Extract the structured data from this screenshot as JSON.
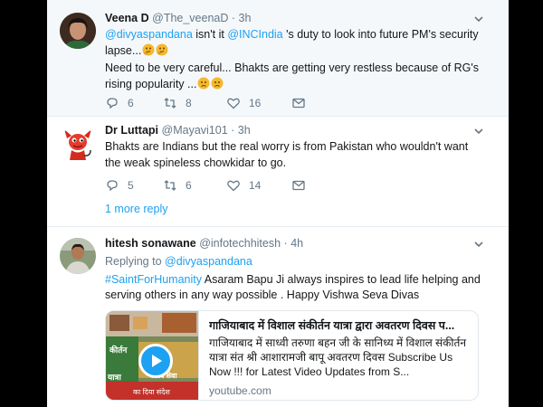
{
  "tweets": [
    {
      "name": "Veena D",
      "handle": "@The_veenaD",
      "separator": "·",
      "time": "3h",
      "text_mention": "@divyaspandana",
      "text_1": " isn't it ",
      "text_mention2": "@INCIndia",
      "text_2": " 's duty to look into future PM's security lapse...",
      "text_3": "Need to be very careful... Bhakts are getting very restless because of RG's rising popularity ...",
      "reply_count": "6",
      "retweet_count": "8",
      "like_count": "16"
    },
    {
      "name": "Dr Luttapi",
      "handle": "@Mayavi101",
      "separator": "·",
      "time": "3h",
      "text": "Bhakts are Indians but the real worry is from Pakistan who wouldn't want the weak spineless chowkidar to go.",
      "reply_count": "5",
      "retweet_count": "6",
      "like_count": "14"
    },
    {
      "name": "hitesh sonawane",
      "handle": "@infotechhitesh",
      "separator": "·",
      "time": "4h",
      "replying_label": "Replying to ",
      "replying_handle": "@divyaspandana",
      "hashtag": "#SaintForHumanity",
      "text": " Asaram Bapu Ji always inspires to lead life helping and serving others in any way possible . Happy Vishwa Seva Divas",
      "card": {
        "title": "गाजियाबाद में विशाल संकीर्तन यात्रा द्वारा अवतरण दिवस प...",
        "description": "गाजियाबाद में साध्वी तरुणा बहन जी के सानिध्य में विशाल संकीर्तन यात्रा संत श्री आशारामजी बापू अवतरण दिवस Subscribe Us Now !!! for Latest Video Updates from S...",
        "domain": "youtube.com",
        "thumb_text_1": "कीर्तन",
        "thumb_text_2": "यात्रा",
        "thumb_text_3": "विश्व सेवा",
        "thumb_text_4": "का दिया संदेश"
      }
    }
  ],
  "more_replies": "1 more reply",
  "colors": {
    "accent": "#1da1f2",
    "muted": "#657786",
    "highlight_bg": "#f5f8fa",
    "emoji": "#f5b82e"
  },
  "icons": [
    "chevron-down-icon",
    "reply-icon",
    "retweet-icon",
    "heart-icon",
    "message-icon",
    "play-icon"
  ]
}
